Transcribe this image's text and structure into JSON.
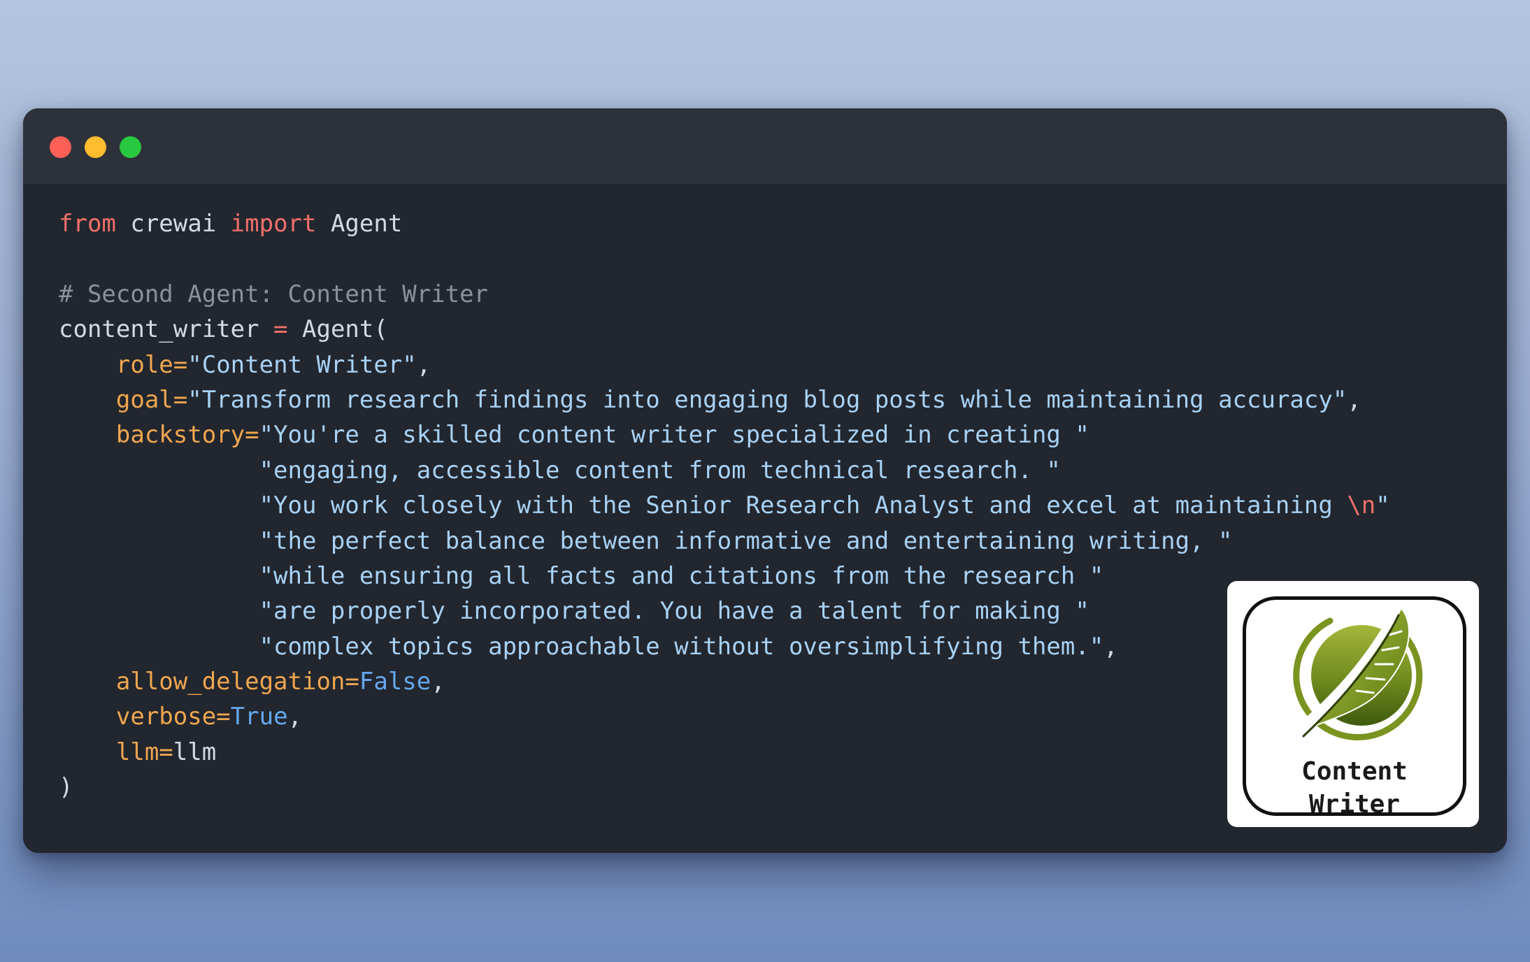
{
  "window": {
    "controls": [
      "close",
      "minimize",
      "maximize"
    ]
  },
  "code": {
    "line1": {
      "kw_from": "from",
      "module": " crewai ",
      "kw_import": "import",
      "name": " Agent"
    },
    "line3": {
      "comment": "# Second Agent: Content Writer"
    },
    "line4": {
      "var": "content_writer ",
      "eq": "=",
      "call": " Agent("
    },
    "line5": {
      "indent": "    ",
      "arg": "role=",
      "value": "\"Content Writer\"",
      "tail": ","
    },
    "line6": {
      "indent": "    ",
      "arg": "goal=",
      "value": "\"Transform research findings into engaging blog posts while maintaining accuracy\"",
      "tail": ","
    },
    "line7": {
      "indent": "    ",
      "arg": "backstory=",
      "value": "\"You're a skilled content writer specialized in creating \""
    },
    "line8": {
      "indent": "              ",
      "value": "\"engaging, accessible content from technical research. \""
    },
    "line9": {
      "indent": "              ",
      "value_pre": "\"You work closely with the Senior Research Analyst and excel at maintaining ",
      "escape": "\\n",
      "value_post": "\""
    },
    "line10": {
      "indent": "              ",
      "value": "\"the perfect balance between informative and entertaining writing, \""
    },
    "line11": {
      "indent": "              ",
      "value": "\"while ensuring all facts and citations from the research \""
    },
    "line12": {
      "indent": "              ",
      "value": "\"are properly incorporated. You have a talent for making \""
    },
    "line13": {
      "indent": "              ",
      "value": "\"complex topics approachable without oversimplifying them.\"",
      "tail": ","
    },
    "line14": {
      "indent": "    ",
      "arg": "allow_delegation=",
      "value": "False",
      "tail": ","
    },
    "line15": {
      "indent": "    ",
      "arg": "verbose=",
      "value": "True",
      "tail": ","
    },
    "line16": {
      "indent": "    ",
      "arg": "llm=",
      "value": "llm"
    },
    "line17": {
      "close": ")"
    }
  },
  "logo": {
    "icon": "quill-feather-icon",
    "line1": "Content",
    "line2": "Writer"
  },
  "colors": {
    "background_top": "#b3c4de",
    "background_bottom": "#6f8abd",
    "window": "#22262e",
    "titlebar": "#2d3139",
    "keyword": "#f0706b",
    "string": "#a8d2f5",
    "argument": "#f0a650",
    "constant": "#65a8ee",
    "comment": "#8b929c"
  }
}
